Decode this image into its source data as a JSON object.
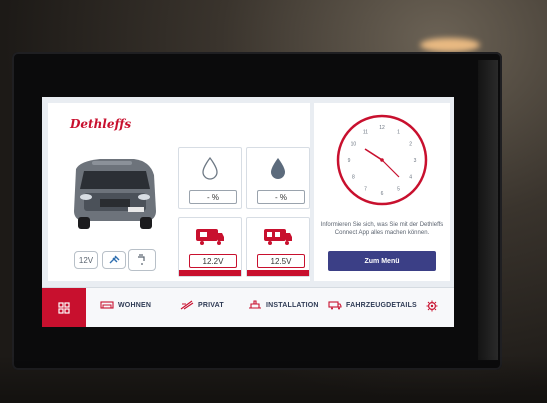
{
  "brand": "Dethleffs",
  "status": {
    "voltage_pill": "12V",
    "tiles": {
      "water_fresh_value": "- %",
      "water_grey_value": "- %",
      "battery1_value": "12.2V",
      "battery2_value": "12.5V"
    }
  },
  "clock": {
    "numbers": [
      "12",
      "1",
      "2",
      "3",
      "4",
      "5",
      "6",
      "7",
      "8",
      "9",
      "10",
      "11"
    ]
  },
  "info_text": "Informieren Sie sich, was Sie mit der Dethleffs Connect App alles machen können.",
  "menu_button": "Zum Menü",
  "nav": {
    "items": [
      {
        "label": "WOHNEN",
        "icon": "living-icon"
      },
      {
        "label": "PRIVAT",
        "icon": "private-icon"
      },
      {
        "label": "INSTALLATION",
        "icon": "installation-icon"
      },
      {
        "label": "FAHRZEUGDETAILS",
        "icon": "vehicle-details-icon"
      }
    ],
    "home_icon": "grid-icon",
    "settings_icon": "gear-icon"
  },
  "colors": {
    "accent": "#c8102e",
    "button": "#3b3f86",
    "nav_text": "#2f3b55"
  }
}
